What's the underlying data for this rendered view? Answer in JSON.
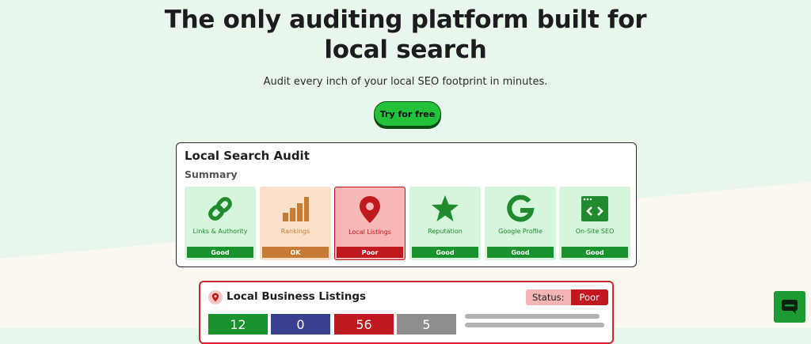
{
  "hero": {
    "title": "The only auditing platform built for local search",
    "subtitle": "Audit every inch of your local SEO footprint in minutes.",
    "cta_label": "Try for free"
  },
  "audit": {
    "title": "Local Search Audit",
    "summary_label": "Summary",
    "cards": [
      {
        "label": "Links & Authority",
        "status": "Good",
        "icon": "link-icon"
      },
      {
        "label": "Rankings",
        "status": "OK",
        "icon": "bar-chart-icon"
      },
      {
        "label": "Local Listings",
        "status": "Poor",
        "icon": "map-pin-icon"
      },
      {
        "label": "Reputation",
        "status": "Good",
        "icon": "star-icon"
      },
      {
        "label": "Google Profile",
        "status": "Good",
        "icon": "google-icon"
      },
      {
        "label": "On-Site SEO",
        "status": "Good",
        "icon": "code-window-icon"
      }
    ]
  },
  "listings": {
    "title": "Local Business Listings",
    "status_label": "Status:",
    "status_value": "Poor",
    "stats": [
      "12",
      "0",
      "56",
      "5"
    ]
  },
  "colors": {
    "good": "#19912c",
    "ok": "#c77a34",
    "poor": "#c0181f",
    "cta": "#23c23a",
    "stat_navy": "#3a3f8f",
    "stat_gray": "#8e8e8e"
  }
}
